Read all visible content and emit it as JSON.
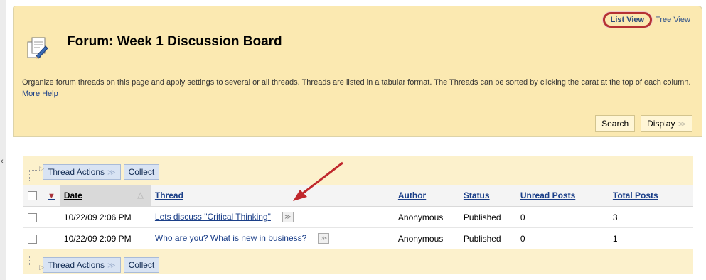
{
  "header": {
    "title": "Forum: Week 1 Discussion Board",
    "view_list": "List View",
    "view_tree": "Tree View",
    "description": "Organize forum threads on this page and apply settings to several or all threads. Threads are listed in a tabular format. The Threads can be sorted by clicking the carat at the top of each column.",
    "more_help": "More Help",
    "search_label": "Search",
    "display_label": "Display"
  },
  "actions": {
    "thread_actions": "Thread Actions",
    "collect": "Collect"
  },
  "table": {
    "columns": [
      "Date",
      "Thread",
      "Author",
      "Status",
      "Unread Posts",
      "Total Posts"
    ],
    "rows": [
      {
        "date": "10/22/09 2:06 PM",
        "thread": "Lets discuss \"Critical Thinking\"",
        "author": "Anonymous",
        "status": "Published",
        "unread": "0",
        "total": "3"
      },
      {
        "date": "10/22/09 2:09 PM",
        "thread": "Who are you? What is new in business?",
        "author": "Anonymous",
        "status": "Published",
        "unread": "0",
        "total": "1"
      }
    ]
  },
  "colors": {
    "header_bg": "#fbe9b1",
    "link": "#1a3e88",
    "highlight_ring": "#b53232",
    "annotation_arrow": "#c0282d"
  }
}
